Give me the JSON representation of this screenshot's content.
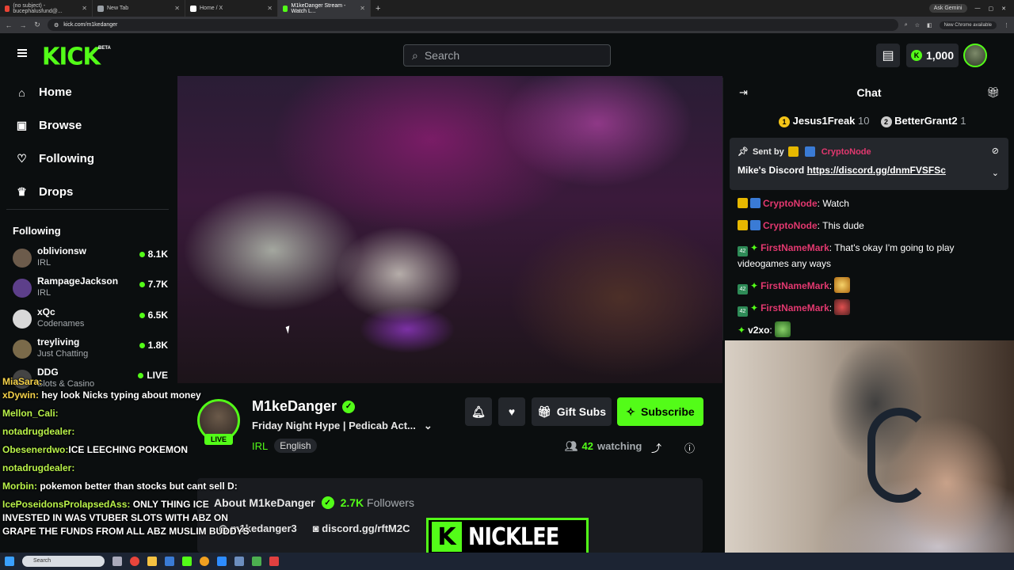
{
  "browser": {
    "tabs": [
      {
        "label": "(no subject) - bucephalusfund@...",
        "color": "#ea4335"
      },
      {
        "label": "New Tab",
        "color": "#9aa0a6"
      },
      {
        "label": "Home / X",
        "color": "#ffffff"
      },
      {
        "label": "M1keDanger Stream - Watch L...",
        "color": "#53fc18"
      }
    ],
    "ask_gemini": "Ask Gemini",
    "url": "kick.com/m1kedanger",
    "new_chrome": "New Chrome available"
  },
  "header": {
    "logo": "KICK",
    "beta": "BETA",
    "search_placeholder": "Search",
    "coins": "1,000"
  },
  "nav": {
    "home": "Home",
    "browse": "Browse",
    "following": "Following",
    "drops": "Drops"
  },
  "following": {
    "title": "Following",
    "channels": [
      {
        "name": "oblivionsw",
        "category": "IRL",
        "viewers": "8.1K"
      },
      {
        "name": "RampageJackson",
        "category": "IRL",
        "viewers": "7.7K"
      },
      {
        "name": "xQc",
        "category": "Codenames",
        "viewers": "6.5K"
      },
      {
        "name": "treyliving",
        "category": "Just Chatting",
        "viewers": "1.8K"
      },
      {
        "name": "DDG",
        "category": "Slots & Casino",
        "viewers": "LIVE"
      }
    ]
  },
  "streamer": {
    "name": "M1keDanger",
    "title": "Friday Night Hype | Pedicab Act...",
    "category": "IRL",
    "language": "English",
    "live": "LIVE",
    "watching_count": "42",
    "watching_label": "watching",
    "gift_subs": "Gift Subs",
    "subscribe": "Subscribe"
  },
  "about": {
    "title": "About M1keDanger",
    "followers_count": "2.7K",
    "followers_label": "Followers",
    "socials": [
      "m1kedanger3",
      "discord.gg/rftM2C"
    ]
  },
  "overlay_chat": [
    {
      "user": "MiaSara:",
      "text": ""
    },
    {
      "user": "xDywin:",
      "text": "hey look Nicks typing about money"
    },
    {
      "user": "Mellon_Cali:",
      "text": ""
    },
    {
      "user": "notadrugdealer:",
      "text": ""
    },
    {
      "user": "Obesenerdwo:",
      "text": "ICE LEECHING POKEMON"
    },
    {
      "user": "notadrugdealer:",
      "text": ""
    },
    {
      "user": "Morbin:",
      "text": "pokemon better than stocks but cant sell D:"
    },
    {
      "user": "IcePoseidonsProlapsedAss:",
      "text": "ONLY THING ICE"
    },
    {
      "user": "",
      "text": "INVESTED IN WAS VTUBER SLOTS WITH ABZ ON"
    },
    {
      "user": "",
      "text": "GRAPE THE FUNDS FROM ALL ABZ MUSLIM BUDDYS"
    }
  ],
  "overlay_brand": "NICKLEE",
  "chat": {
    "title": "Chat",
    "leaders": [
      {
        "rank": "1",
        "name": "Jesus1Freak",
        "count": "10"
      },
      {
        "rank": "2",
        "name": "BetterGrant2",
        "count": "1"
      }
    ],
    "pinned": {
      "sent_by": "Sent by",
      "sender": "CryptoNode",
      "text": "Mike's Discord",
      "link": "https://discord.gg/dnmFVSFSc"
    },
    "messages": [
      {
        "user": "CryptoNode",
        "text": "Watch"
      },
      {
        "user": "CryptoNode",
        "text": "This dude"
      },
      {
        "user": "FirstNameMark",
        "text": "That's okay I'm going to play videogames any ways"
      },
      {
        "user": "FirstNameMark",
        "text": ""
      },
      {
        "user": "FirstNameMark",
        "text": ""
      },
      {
        "user": "v2xo",
        "text": ""
      }
    ]
  },
  "taskbar": {
    "search": "Search"
  }
}
